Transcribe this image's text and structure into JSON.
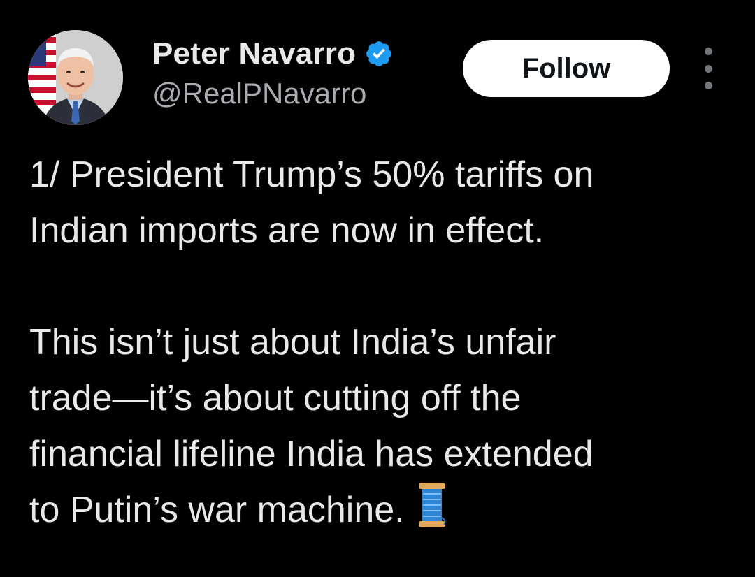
{
  "author": {
    "display_name": "Peter Navarro",
    "handle": "@RealPNavarro",
    "verified": true,
    "verified_color": "#1d9bf0",
    "avatar_icon": "avatar-photo"
  },
  "actions": {
    "follow_label": "Follow",
    "more_icon": "more-vertical-icon"
  },
  "tweet": {
    "paragraph_1": "1/ President Trump’s 50% tariffs on\nIndian imports are now in effect.",
    "paragraph_2": "This isn’t just about India’s unfair\ntrade—it’s about cutting off the\nfinancial lifeline India has extended\nto Putin’s war machine.",
    "emoji": "spool-of-thread-emoji"
  },
  "colors": {
    "background": "#000000",
    "text_primary": "#e7e9ea",
    "text_secondary": "#a9adb2",
    "button_bg": "#ffffff",
    "button_text": "#0f1419"
  }
}
